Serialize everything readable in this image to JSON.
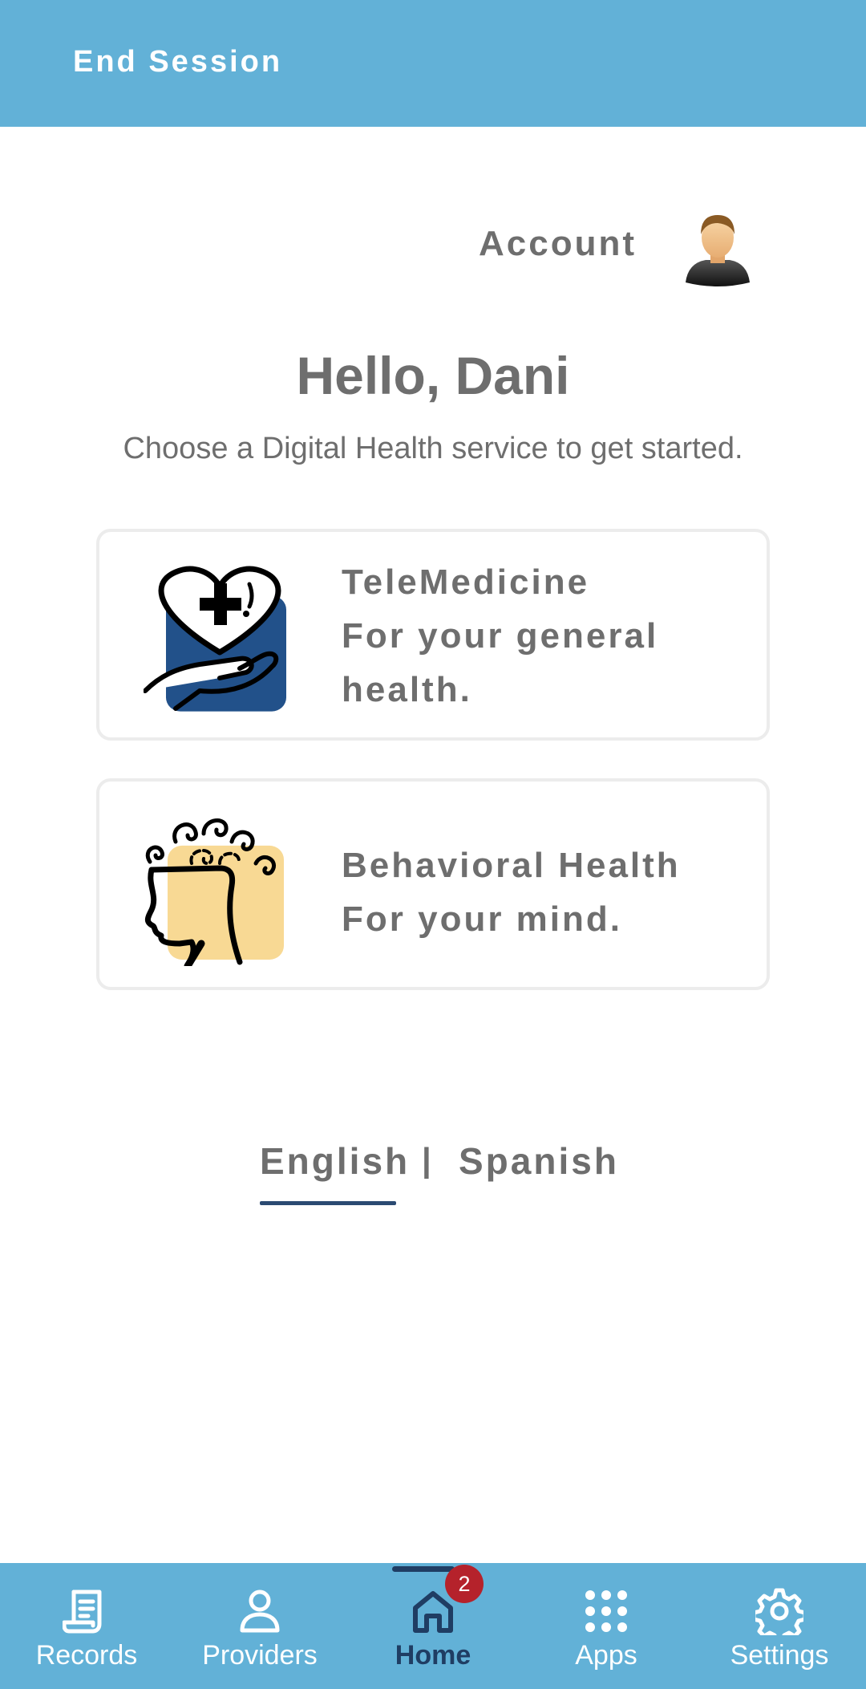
{
  "header": {
    "end_session_label": "End Session"
  },
  "account": {
    "label": "Account",
    "avatar_icon": "user-avatar-icon"
  },
  "greeting": "Hello, Dani",
  "subtitle": "Choose a Digital Health service to get started.",
  "services": [
    {
      "title": "TeleMedicine",
      "description_line1": "For your general",
      "description_line2": "health.",
      "icon": "heart-hand-icon",
      "icon_bg": "#22518a"
    },
    {
      "title": "Behavioral Health",
      "description": "For your mind.",
      "icon": "mind-head-icon",
      "icon_bg": "#f8d994"
    }
  ],
  "language": {
    "english": "English",
    "separator": "|",
    "spanish": "Spanish",
    "selected": "English"
  },
  "bottom_nav": {
    "items": [
      {
        "label": "Records",
        "icon": "records-icon"
      },
      {
        "label": "Providers",
        "icon": "person-icon"
      },
      {
        "label": "Home",
        "icon": "home-icon",
        "badge": "2",
        "active": true
      },
      {
        "label": "Apps",
        "icon": "apps-grid-icon"
      },
      {
        "label": "Settings",
        "icon": "gear-icon"
      }
    ]
  },
  "colors": {
    "bar": "#62b1d7",
    "active": "#1f3d63",
    "text": "#6e6e6e",
    "badge": "#b5222b"
  }
}
